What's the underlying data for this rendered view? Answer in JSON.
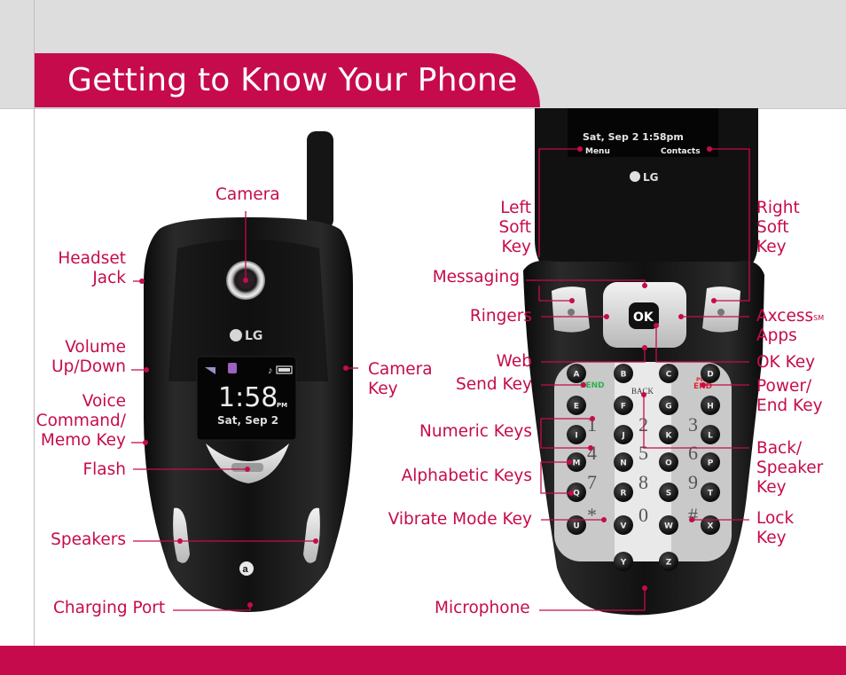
{
  "page": {
    "title": "Getting to Know Your Phone",
    "accent_color": "#c60b4c",
    "band_color": "#dddddd"
  },
  "closed_phone": {
    "external_screen": {
      "time": "1:58",
      "ampm": "PM",
      "date": "Sat, Sep 2"
    },
    "logo": "LG",
    "carrier_logo": "a",
    "labels": {
      "camera": "Camera",
      "headset_jack": [
        "Headset",
        "Jack"
      ],
      "volume": [
        "Volume",
        "Up/Down"
      ],
      "voice_command": [
        "Voice",
        "Command/",
        "Memo Key"
      ],
      "flash": "Flash",
      "camera_key": [
        "Camera",
        "Key"
      ],
      "speakers": "Speakers",
      "charging_port": "Charging Port"
    }
  },
  "open_phone": {
    "internal_screen": {
      "datetime": "Sat, Sep 2 1:58pm",
      "left_softkey": "Menu",
      "right_softkey": "Contacts"
    },
    "logo": "LG",
    "ok_key": "OK",
    "send_key": "SEND",
    "end_key_top": "PWR",
    "end_key": "END",
    "back_key": "BACK",
    "numbers": [
      "1",
      "2",
      "3",
      "4",
      "5",
      "6",
      "7",
      "8",
      "9",
      "*",
      "0",
      "#"
    ],
    "letters": [
      "A",
      "B",
      "C",
      "D",
      "E",
      "F",
      "G",
      "H",
      "I",
      "J",
      "K",
      "L",
      "M",
      "N",
      "O",
      "P",
      "Q",
      "R",
      "S",
      "T",
      "U",
      "V",
      "W",
      "X",
      "Y",
      "Z"
    ],
    "labels": {
      "left_soft_key": [
        "Left",
        "Soft",
        "Key"
      ],
      "right_soft_key": [
        "Right",
        "Soft",
        "Key"
      ],
      "messaging": "Messaging",
      "ringers": "Ringers",
      "axcess_apps": [
        "Axcess",
        "SM",
        "Apps"
      ],
      "web": "Web",
      "ok_key": "OK Key",
      "send_key": "Send Key",
      "power_end": [
        "Power/",
        "End Key"
      ],
      "numeric_keys": "Numeric Keys",
      "back_speaker": [
        "Back/",
        "Speaker",
        "Key"
      ],
      "alphabetic_keys": "Alphabetic Keys",
      "vibrate_mode": "Vibrate Mode Key",
      "lock_key": [
        "Lock",
        "Key"
      ],
      "microphone": "Microphone"
    }
  }
}
